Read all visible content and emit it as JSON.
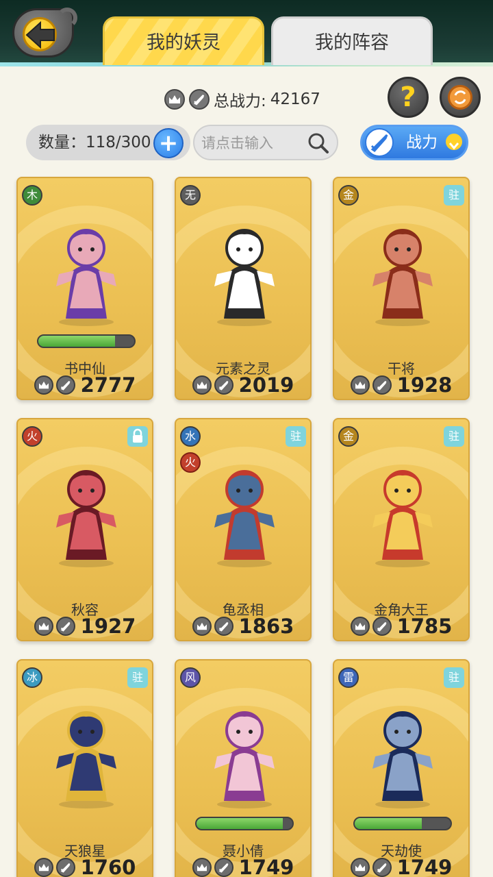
{
  "tabs": [
    {
      "label": "我的妖灵",
      "active": true
    },
    {
      "label": "我的阵容",
      "active": false
    }
  ],
  "summary": {
    "total_power_label": "总战力:",
    "total_power_value": "42167",
    "help_label": "?"
  },
  "filter": {
    "count_label": "数量：",
    "count_value": "118/300",
    "add_label": "+",
    "search_placeholder": "请点击输入",
    "sort_label": "战力"
  },
  "cards": [
    {
      "name": "书中仙",
      "power": "2777",
      "element": "木",
      "element_color": "#3f8b3a",
      "hp_fraction": 0.8,
      "badge": "",
      "body_color": "#e8a9b8",
      "accent_color": "#6a3da8"
    },
    {
      "name": "元素之灵",
      "power": "2019",
      "element": "无",
      "element_color": "#5e5e5e",
      "badge": "",
      "body_color": "#ffffff",
      "accent_color": "#2a2a2a"
    },
    {
      "name": "干将",
      "power": "1928",
      "element": "金",
      "element_color": "#b5861e",
      "badge": "驻",
      "body_color": "#d7826a",
      "accent_color": "#8a2d1a"
    },
    {
      "name": "秋容",
      "power": "1927",
      "element": "火",
      "element_color": "#c2402c",
      "badge": "lock",
      "body_color": "#d85a63",
      "accent_color": "#6a1a25"
    },
    {
      "name": "龟丞相",
      "power": "1863",
      "element": "水",
      "element2": "火",
      "element_color": "#3474b8",
      "badge": "驻",
      "body_color": "#4a6e9a",
      "accent_color": "#c23b2e"
    },
    {
      "name": "金角大王",
      "power": "1785",
      "element": "金",
      "element_color": "#b5861e",
      "badge": "驻",
      "body_color": "#f4cc5a",
      "accent_color": "#c73a2c"
    },
    {
      "name": "天狼星",
      "power": "1760",
      "element": "冰",
      "element_color": "#3c9bc0",
      "badge": "驻",
      "body_color": "#2f3a73",
      "accent_color": "#e0b53a"
    },
    {
      "name": "聂小倩",
      "power": "1749",
      "element": "风",
      "element_color": "#5d55a8",
      "hp_fraction": 0.9,
      "badge": "",
      "body_color": "#f2c6d6",
      "accent_color": "#8a3c92"
    },
    {
      "name": "天劫使",
      "power": "1749",
      "element": "雷",
      "element_color": "#3d66b8",
      "hp_fraction": 0.7,
      "badge": "驻",
      "body_color": "#8aa2c8",
      "accent_color": "#1b2b5a"
    }
  ]
}
